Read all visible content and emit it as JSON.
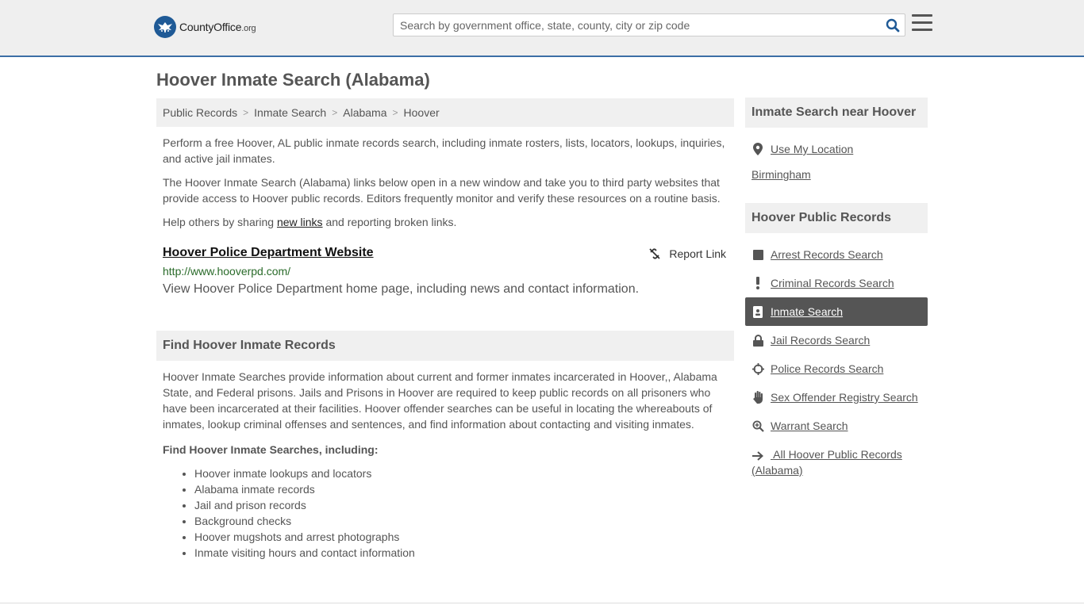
{
  "header": {
    "logo_name": "County",
    "logo_accent": "Office",
    "logo_tld": ".org",
    "search_placeholder": "Search by government office, state, county, city or zip code"
  },
  "page": {
    "title": "Hoover Inmate Search (Alabama)"
  },
  "breadcrumb": [
    "Public Records",
    "Inmate Search",
    "Alabama",
    "Hoover"
  ],
  "intro": {
    "p1": "Perform a free Hoover, AL public inmate records search, including inmate rosters, lists, locators, lookups, inquiries, and active jail inmates.",
    "p2": "The Hoover Inmate Search (Alabama) links below open in a new window and take you to third party websites that provide access to Hoover public records. Editors frequently monitor and verify these resources on a routine basis.",
    "p3_before": "Help others by sharing ",
    "p3_link": "new links",
    "p3_after": " and reporting broken links."
  },
  "result": {
    "title": "Hoover Police Department Website",
    "url": "http://www.hooverpd.com/",
    "description": "View Hoover Police Department home page, including news and contact information.",
    "report_label": "Report Link"
  },
  "find": {
    "heading": "Find Hoover Inmate Records",
    "paragraph": "Hoover Inmate Searches provide information about current and former inmates incarcerated in Hoover,, Alabama State, and Federal prisons. Jails and Prisons in Hoover are required to keep public records on all prisoners who have been incarcerated at their facilities. Hoover offender searches can be useful in locating the whereabouts of inmates, lookup criminal offenses and sentences, and find information about contacting and visiting inmates.",
    "subheading": "Find Hoover Inmate Searches, including:",
    "items": [
      "Hoover inmate lookups and locators",
      "Alabama inmate records",
      "Jail and prison records",
      "Background checks",
      "Hoover mugshots and arrest photographs",
      "Inmate visiting hours and contact information"
    ]
  },
  "sidebar": {
    "near_heading": "Inmate Search near Hoover",
    "use_location": "Use My Location",
    "nearby": [
      "Birmingham"
    ],
    "records_heading": "Hoover Public Records",
    "links": [
      {
        "label": "Arrest Records Search",
        "icon": "square-icon"
      },
      {
        "label": "Criminal Records Search",
        "icon": "exclamation-icon"
      },
      {
        "label": "Inmate Search",
        "icon": "id-badge-icon",
        "active": true
      },
      {
        "label": "Jail Records Search",
        "icon": "lock-icon"
      },
      {
        "label": "Police Records Search",
        "icon": "crosshair-icon"
      },
      {
        "label": "Sex Offender Registry Search",
        "icon": "hand-icon"
      },
      {
        "label": "Warrant Search",
        "icon": "search-plus-icon"
      }
    ],
    "all_records": "All Hoover Public Records (Alabama)"
  },
  "colors": {
    "header_bg": "#efefef",
    "header_border": "#3b6ea5",
    "brand_blue": "#1f5a96",
    "active_bg": "#555555",
    "url_green": "#2a6b2a"
  }
}
